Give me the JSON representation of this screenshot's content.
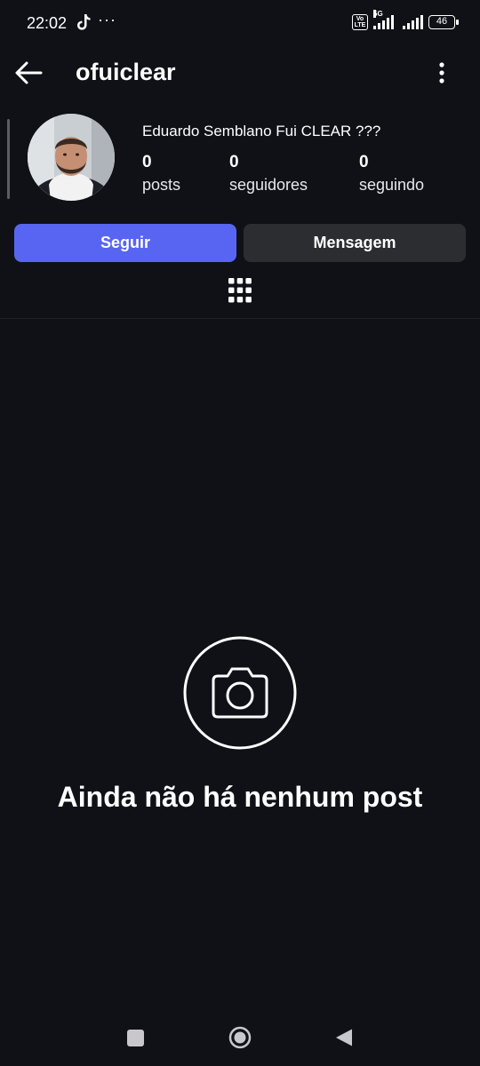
{
  "status_bar": {
    "time": "22:02",
    "dots": "···",
    "volte": "Vo LTE",
    "network": "5G",
    "battery": "46"
  },
  "header": {
    "username": "ofuiclear",
    "back_icon": "arrow-left-icon",
    "menu_icon": "more-vertical-icon"
  },
  "profile": {
    "display_name": "Eduardo Semblano Fui CLEAR ???",
    "stats": [
      {
        "value": "0",
        "label": "posts"
      },
      {
        "value": "0",
        "label": "seguidores"
      },
      {
        "value": "0",
        "label": "seguindo"
      }
    ]
  },
  "actions": {
    "follow_label": "Seguir",
    "message_label": "Mensagem"
  },
  "tabs": {
    "grid_icon": "grid-icon"
  },
  "empty_state": {
    "icon": "camera-icon",
    "title": "Ainda não há nenhum post"
  },
  "nav_bar": {
    "recents_icon": "square-icon",
    "home_icon": "circle-icon",
    "back_icon": "triangle-back-icon"
  },
  "colors": {
    "background": "#0f1117",
    "follow_button": "#5865f2",
    "message_button": "#2b2d31"
  }
}
